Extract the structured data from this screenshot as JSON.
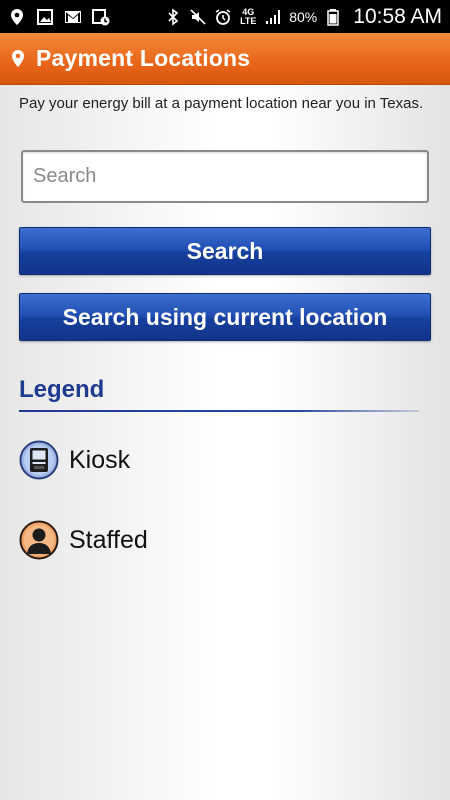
{
  "status_bar": {
    "left_icons": [
      "location-icon",
      "image-icon",
      "gmail-icon",
      "calendar-clock-icon"
    ],
    "right_icons": [
      "bluetooth-icon",
      "mute-icon",
      "alarm-icon",
      "4g-lte-icon",
      "signal-icon",
      "battery-icon"
    ],
    "network_label": "4G LTE",
    "battery_percent": "80%",
    "time": "10:58 AM"
  },
  "app_bar": {
    "icon": "location-pin-icon",
    "title": "Payment Locations",
    "color": "#e8651a"
  },
  "intro_text": "Pay your energy bill at a payment location near you in Texas.",
  "search": {
    "placeholder": "Search",
    "value": ""
  },
  "buttons": {
    "search_label": "Search",
    "current_location_label": "Search using current location",
    "color": "#1c47a8"
  },
  "legend": {
    "title": "Legend",
    "items": [
      {
        "icon": "kiosk-icon",
        "label": "Kiosk"
      },
      {
        "icon": "staffed-person-icon",
        "label": "Staffed"
      }
    ]
  }
}
